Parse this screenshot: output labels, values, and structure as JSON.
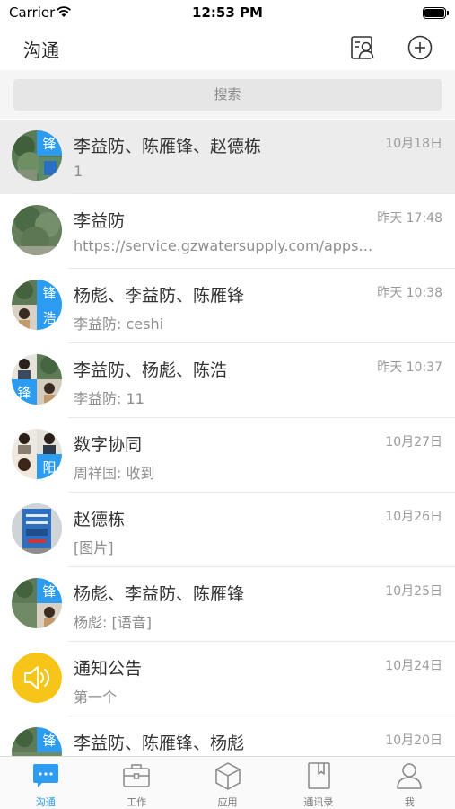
{
  "status_bar": {
    "carrier": "Carrier",
    "time": "12:53 PM"
  },
  "header": {
    "title": "沟通"
  },
  "search": {
    "placeholder": "搜索"
  },
  "colors": {
    "accent": "#2d9bf0",
    "notice_badge": "#f6c517",
    "selected_row": "#ececec"
  },
  "conversations": [
    {
      "name": "李益防、陈雁锋、赵德栋",
      "preview": "1",
      "time": "10月18日",
      "avatar_chars": [
        "锋"
      ],
      "selected": true
    },
    {
      "name": "李益防",
      "preview": "https://service.gzwatersupply.com/apps…",
      "time": "昨天 17:48"
    },
    {
      "name": "杨彪、李益防、陈雁锋",
      "preview": "李益防: ceshi",
      "time": "昨天 10:38",
      "avatar_chars": [
        "锋",
        "浩"
      ]
    },
    {
      "name": "李益防、杨彪、陈浩",
      "preview": "李益防: 11",
      "time": "昨天 10:37",
      "avatar_chars": [
        "锋"
      ]
    },
    {
      "name": "数字协同",
      "preview": "周祥国: 收到",
      "time": "10月27日",
      "avatar_chars": [
        "阳"
      ]
    },
    {
      "name": "赵德栋",
      "preview": "[图片]",
      "time": "10月26日"
    },
    {
      "name": "杨彪、李益防、陈雁锋",
      "preview": "杨彪: [语音]",
      "time": "10月25日",
      "avatar_chars": [
        "锋"
      ]
    },
    {
      "name": "通知公告",
      "preview": "第一个",
      "time": "10月24日",
      "avatar_icon": "speaker-icon"
    },
    {
      "name": "李益防、陈雁锋、杨彪",
      "preview": "",
      "time": "10月20日",
      "avatar_chars": [
        "锋"
      ]
    }
  ],
  "tabs": [
    {
      "label": "沟通",
      "icon": "chat-bubble-icon",
      "active": true
    },
    {
      "label": "工作",
      "icon": "briefcase-icon"
    },
    {
      "label": "应用",
      "icon": "cube-icon"
    },
    {
      "label": "通讯录",
      "icon": "book-icon"
    },
    {
      "label": "我",
      "icon": "person-icon"
    }
  ]
}
